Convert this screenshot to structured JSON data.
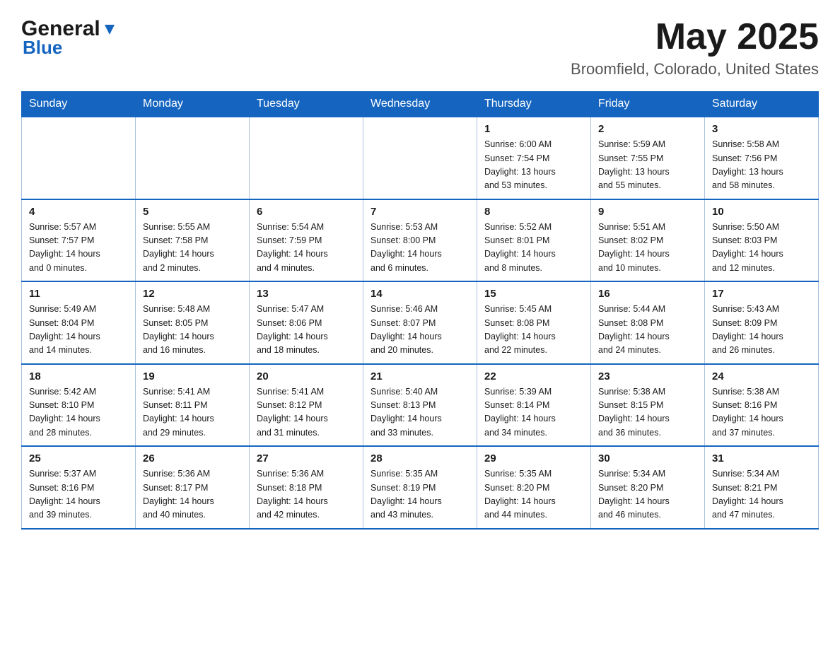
{
  "header": {
    "logo_general": "General",
    "logo_blue": "Blue",
    "month_title": "May 2025",
    "location": "Broomfield, Colorado, United States"
  },
  "days_of_week": [
    "Sunday",
    "Monday",
    "Tuesday",
    "Wednesday",
    "Thursday",
    "Friday",
    "Saturday"
  ],
  "weeks": [
    [
      {
        "day": "",
        "info": ""
      },
      {
        "day": "",
        "info": ""
      },
      {
        "day": "",
        "info": ""
      },
      {
        "day": "",
        "info": ""
      },
      {
        "day": "1",
        "info": "Sunrise: 6:00 AM\nSunset: 7:54 PM\nDaylight: 13 hours\nand 53 minutes."
      },
      {
        "day": "2",
        "info": "Sunrise: 5:59 AM\nSunset: 7:55 PM\nDaylight: 13 hours\nand 55 minutes."
      },
      {
        "day": "3",
        "info": "Sunrise: 5:58 AM\nSunset: 7:56 PM\nDaylight: 13 hours\nand 58 minutes."
      }
    ],
    [
      {
        "day": "4",
        "info": "Sunrise: 5:57 AM\nSunset: 7:57 PM\nDaylight: 14 hours\nand 0 minutes."
      },
      {
        "day": "5",
        "info": "Sunrise: 5:55 AM\nSunset: 7:58 PM\nDaylight: 14 hours\nand 2 minutes."
      },
      {
        "day": "6",
        "info": "Sunrise: 5:54 AM\nSunset: 7:59 PM\nDaylight: 14 hours\nand 4 minutes."
      },
      {
        "day": "7",
        "info": "Sunrise: 5:53 AM\nSunset: 8:00 PM\nDaylight: 14 hours\nand 6 minutes."
      },
      {
        "day": "8",
        "info": "Sunrise: 5:52 AM\nSunset: 8:01 PM\nDaylight: 14 hours\nand 8 minutes."
      },
      {
        "day": "9",
        "info": "Sunrise: 5:51 AM\nSunset: 8:02 PM\nDaylight: 14 hours\nand 10 minutes."
      },
      {
        "day": "10",
        "info": "Sunrise: 5:50 AM\nSunset: 8:03 PM\nDaylight: 14 hours\nand 12 minutes."
      }
    ],
    [
      {
        "day": "11",
        "info": "Sunrise: 5:49 AM\nSunset: 8:04 PM\nDaylight: 14 hours\nand 14 minutes."
      },
      {
        "day": "12",
        "info": "Sunrise: 5:48 AM\nSunset: 8:05 PM\nDaylight: 14 hours\nand 16 minutes."
      },
      {
        "day": "13",
        "info": "Sunrise: 5:47 AM\nSunset: 8:06 PM\nDaylight: 14 hours\nand 18 minutes."
      },
      {
        "day": "14",
        "info": "Sunrise: 5:46 AM\nSunset: 8:07 PM\nDaylight: 14 hours\nand 20 minutes."
      },
      {
        "day": "15",
        "info": "Sunrise: 5:45 AM\nSunset: 8:08 PM\nDaylight: 14 hours\nand 22 minutes."
      },
      {
        "day": "16",
        "info": "Sunrise: 5:44 AM\nSunset: 8:08 PM\nDaylight: 14 hours\nand 24 minutes."
      },
      {
        "day": "17",
        "info": "Sunrise: 5:43 AM\nSunset: 8:09 PM\nDaylight: 14 hours\nand 26 minutes."
      }
    ],
    [
      {
        "day": "18",
        "info": "Sunrise: 5:42 AM\nSunset: 8:10 PM\nDaylight: 14 hours\nand 28 minutes."
      },
      {
        "day": "19",
        "info": "Sunrise: 5:41 AM\nSunset: 8:11 PM\nDaylight: 14 hours\nand 29 minutes."
      },
      {
        "day": "20",
        "info": "Sunrise: 5:41 AM\nSunset: 8:12 PM\nDaylight: 14 hours\nand 31 minutes."
      },
      {
        "day": "21",
        "info": "Sunrise: 5:40 AM\nSunset: 8:13 PM\nDaylight: 14 hours\nand 33 minutes."
      },
      {
        "day": "22",
        "info": "Sunrise: 5:39 AM\nSunset: 8:14 PM\nDaylight: 14 hours\nand 34 minutes."
      },
      {
        "day": "23",
        "info": "Sunrise: 5:38 AM\nSunset: 8:15 PM\nDaylight: 14 hours\nand 36 minutes."
      },
      {
        "day": "24",
        "info": "Sunrise: 5:38 AM\nSunset: 8:16 PM\nDaylight: 14 hours\nand 37 minutes."
      }
    ],
    [
      {
        "day": "25",
        "info": "Sunrise: 5:37 AM\nSunset: 8:16 PM\nDaylight: 14 hours\nand 39 minutes."
      },
      {
        "day": "26",
        "info": "Sunrise: 5:36 AM\nSunset: 8:17 PM\nDaylight: 14 hours\nand 40 minutes."
      },
      {
        "day": "27",
        "info": "Sunrise: 5:36 AM\nSunset: 8:18 PM\nDaylight: 14 hours\nand 42 minutes."
      },
      {
        "day": "28",
        "info": "Sunrise: 5:35 AM\nSunset: 8:19 PM\nDaylight: 14 hours\nand 43 minutes."
      },
      {
        "day": "29",
        "info": "Sunrise: 5:35 AM\nSunset: 8:20 PM\nDaylight: 14 hours\nand 44 minutes."
      },
      {
        "day": "30",
        "info": "Sunrise: 5:34 AM\nSunset: 8:20 PM\nDaylight: 14 hours\nand 46 minutes."
      },
      {
        "day": "31",
        "info": "Sunrise: 5:34 AM\nSunset: 8:21 PM\nDaylight: 14 hours\nand 47 minutes."
      }
    ]
  ]
}
